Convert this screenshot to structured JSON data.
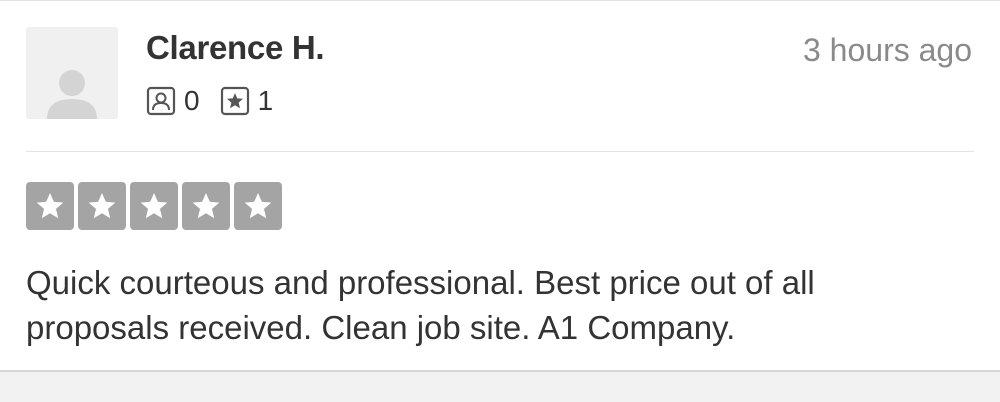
{
  "review": {
    "author": {
      "name": "Clarence H.",
      "avatar_icon": "user-silhouette-icon",
      "friends_count": "0",
      "friends_icon": "user-badge-icon",
      "reviews_count": "1",
      "reviews_icon": "star-badge-icon"
    },
    "timestamp": "3 hours ago",
    "rating": {
      "value": 5,
      "max": 5,
      "star_icon": "star-icon",
      "star_color": "#a4a4a4"
    },
    "text": "Quick courteous and professional. Best price out of all proposals received. Clean job site. A1 Company."
  }
}
